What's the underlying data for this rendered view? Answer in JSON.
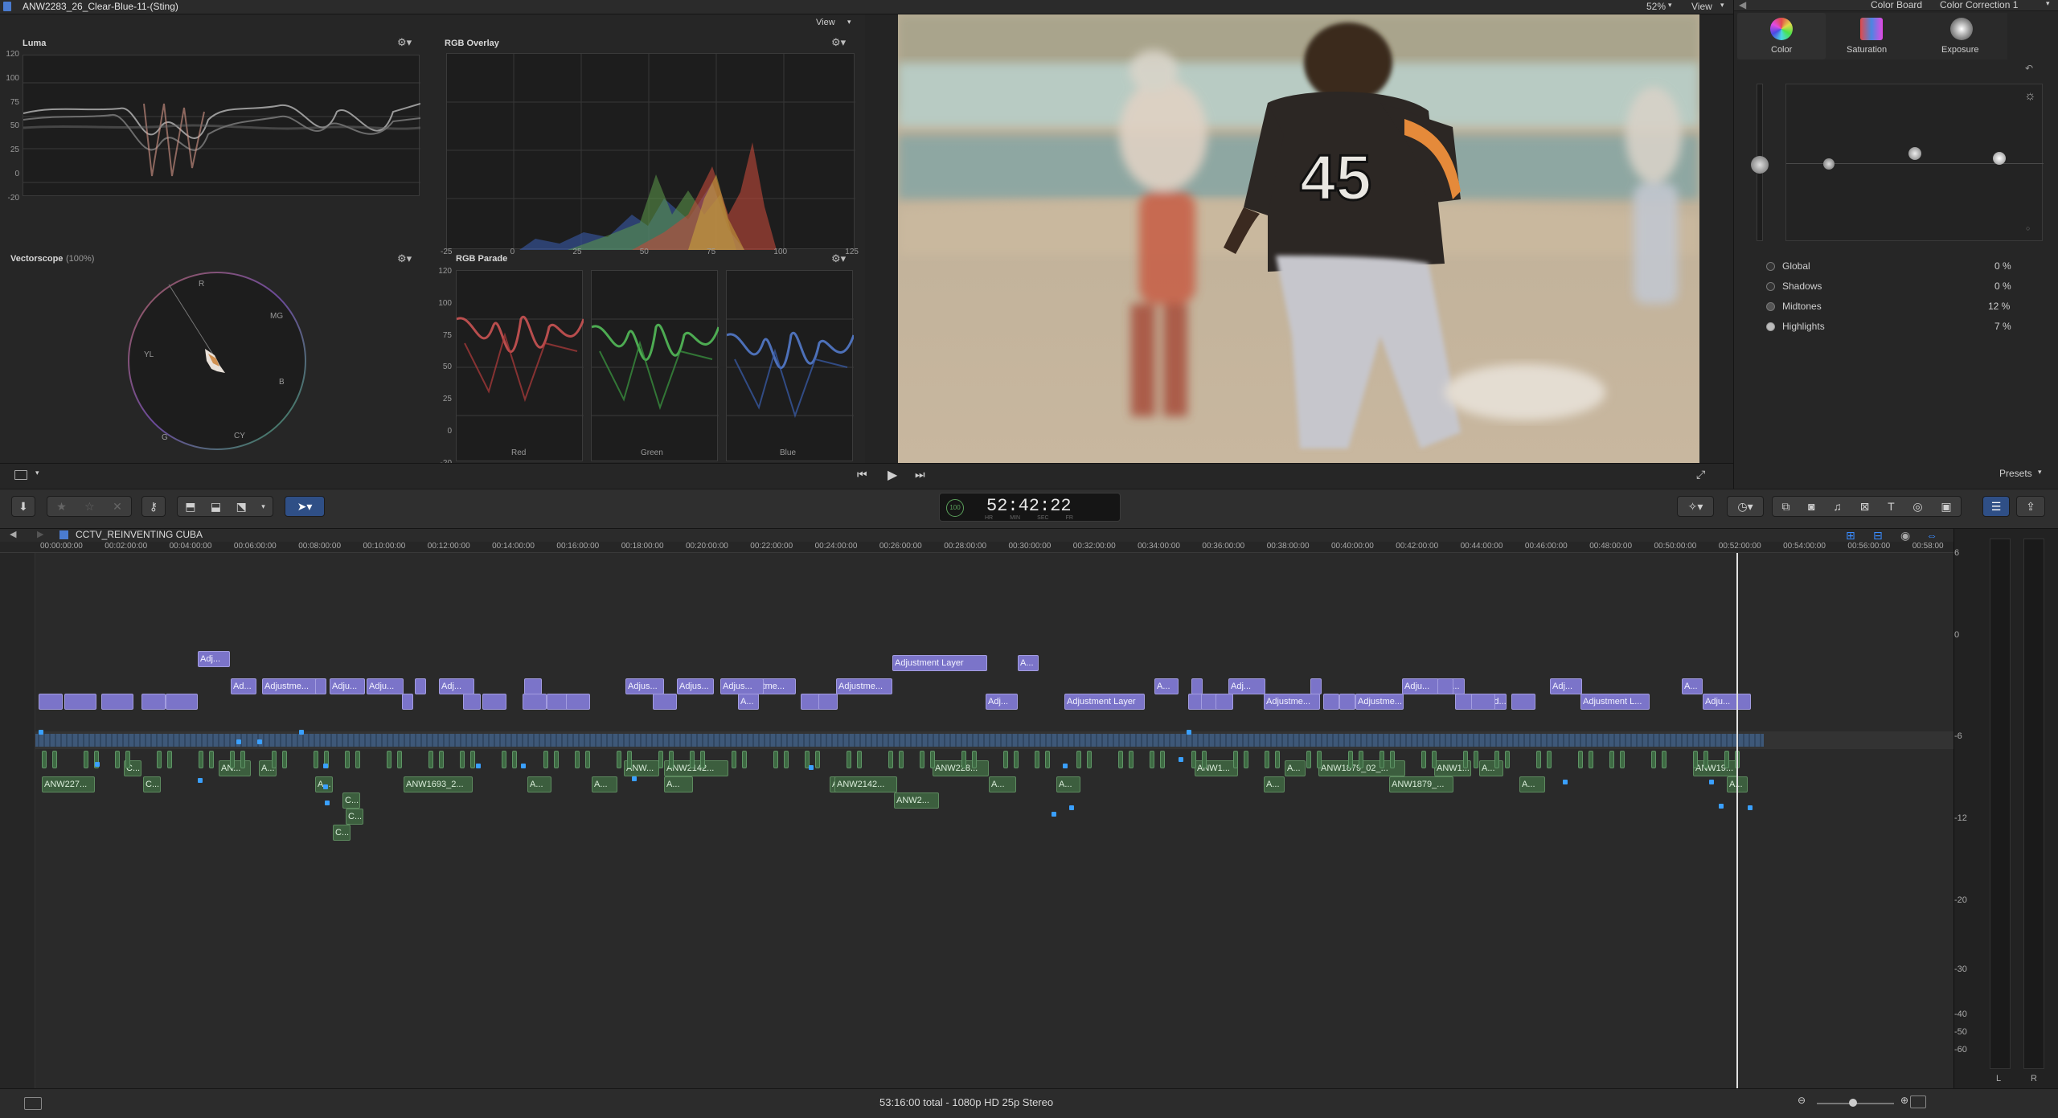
{
  "window": {
    "title": "ANW2283_26_Clear-Blue-11-(Sting)",
    "zoom": "52%",
    "view_label": "View"
  },
  "scopes": {
    "view_label": "View",
    "luma": {
      "title": "Luma",
      "ticks": [
        "120",
        "100",
        "75",
        "50",
        "25",
        "0",
        "-20"
      ]
    },
    "rgb_overlay": {
      "title": "RGB Overlay",
      "xticks": [
        "-25",
        "0",
        "25",
        "50",
        "75",
        "100",
        "125"
      ]
    },
    "vectorscope": {
      "title": "Vectorscope",
      "pct": "(100%)",
      "labels": {
        "r": "R",
        "mg": "MG",
        "b": "B",
        "cy": "CY",
        "g": "G",
        "yl": "YL"
      }
    },
    "rgb_parade": {
      "title": "RGB Parade",
      "ticks": [
        "120",
        "100",
        "75",
        "50",
        "25",
        "0",
        "-20"
      ],
      "channels": [
        "Red",
        "Green",
        "Blue"
      ]
    }
  },
  "viewer": {
    "jersey_text": "45"
  },
  "inspector": {
    "title": "Color Board",
    "correction": "Color Correction 1",
    "tabs": [
      "Color",
      "Saturation",
      "Exposure"
    ],
    "ranges": [
      {
        "label": "Global",
        "value": "0 %"
      },
      {
        "label": "Shadows",
        "value": "0 %"
      },
      {
        "label": "Midtones",
        "value": "12 %"
      },
      {
        "label": "Highlights",
        "value": "7 %"
      }
    ],
    "presets": "Presets"
  },
  "toolbar": {
    "timecode": "52:42:22",
    "timecode_units": [
      "HR",
      "MIN",
      "SEC",
      "FR"
    ],
    "timecode_pct": "100"
  },
  "timeline": {
    "project": "CCTV_REINVENTING CUBA",
    "ruler": [
      "00:00:00:00",
      "00:02:00:00",
      "00:04:00:00",
      "00:06:00:00",
      "00:08:00:00",
      "00:10:00:00",
      "00:12:00:00",
      "00:14:00:00",
      "00:16:00:00",
      "00:18:00:00",
      "00:20:00:00",
      "00:22:00:00",
      "00:24:00:00",
      "00:26:00:00",
      "00:28:00:00",
      "00:30:00:00",
      "00:32:00:00",
      "00:34:00:00",
      "00:36:00:00",
      "00:38:00:00",
      "00:40:00:00",
      "00:42:00:00",
      "00:44:00:00",
      "00:46:00:00",
      "00:48:00:00",
      "00:50:00:00",
      "00:52:00:00",
      "00:54:00:00",
      "00:56:00:00",
      "00:58:00"
    ],
    "adj_labels": [
      "Adj...",
      "Ad...",
      "Adjustme...",
      "Adju...",
      "Adju...",
      "Adj...",
      "Adjus...",
      "Adjus...",
      "Adjustme...",
      "A...",
      "Adjus...",
      "Adjustme...",
      "Adjustment Layer",
      "A...",
      "A...",
      "Adj...",
      "Adju...",
      "A...",
      "Adj...",
      "A...",
      "Ad...",
      "Adj...",
      "Adjustment Layer",
      "Adjustme...",
      "Adjustme...",
      "Adjustment L...",
      "Adju..."
    ],
    "vid_labels": [
      "ANW227...",
      "C...",
      "C...",
      "AN...",
      "A...",
      "A...",
      "C...",
      "ANW1693_2...",
      "A...",
      "A...",
      "ANW...",
      "ANW2142...",
      "A...",
      "A...",
      "ANW2142...",
      "ANW2...",
      "ANW228...",
      "A...",
      "A...",
      "ANW1...",
      "A...",
      "ANW1879_02_...",
      "A...",
      "ANW1879_...",
      "ANW1...",
      "A...",
      "A...",
      "ANW19...",
      "A...",
      "C...",
      "C..."
    ]
  },
  "meters": {
    "scale": [
      "6",
      "0",
      "-6",
      "-12",
      "-20",
      "-30",
      "-40",
      "-50",
      "-60"
    ],
    "channels": [
      "L",
      "R"
    ]
  },
  "status": {
    "text": "53:16:00 total - 1080p HD 25p Stereo"
  }
}
